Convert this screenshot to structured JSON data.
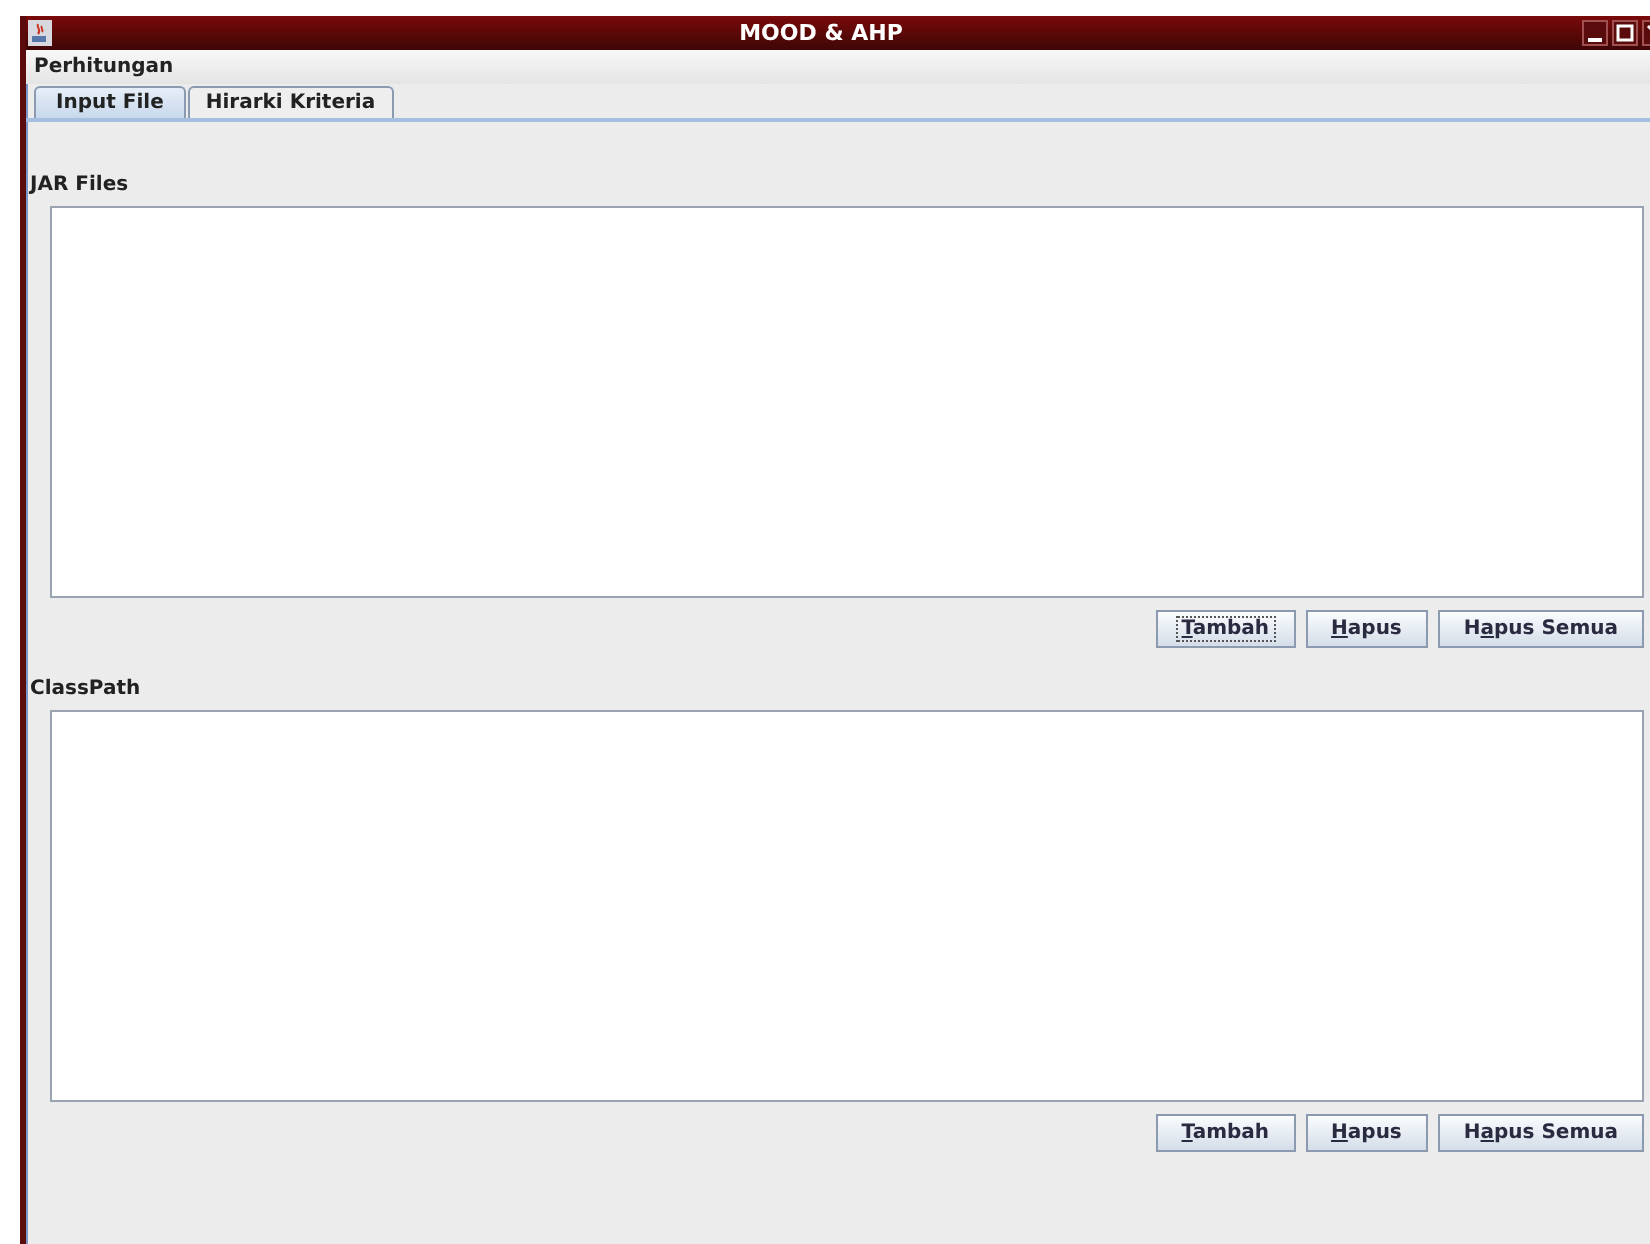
{
  "window": {
    "title": "MOOD & AHP"
  },
  "menu": [
    "Perhitungan"
  ],
  "tabs": [
    {
      "label": "Input File",
      "selected": true
    },
    {
      "label": "Hirarki Kriteria",
      "selected": false
    }
  ],
  "sections": [
    {
      "label": "JAR Files",
      "buttons": [
        {
          "key": "T",
          "after": "ambah",
          "focused": true
        },
        {
          "key": "H",
          "after": "apus",
          "focused": false
        },
        {
          "before": "H",
          "key": "a",
          "after": "pus Semua",
          "focused": false
        }
      ]
    },
    {
      "label": "ClassPath",
      "buttons": [
        {
          "key": "T",
          "after": "ambah",
          "focused": false
        },
        {
          "key": "H",
          "after": "apus",
          "focused": false
        },
        {
          "before": "H",
          "key": "a",
          "after": "pus Semua",
          "focused": false
        }
      ]
    }
  ]
}
